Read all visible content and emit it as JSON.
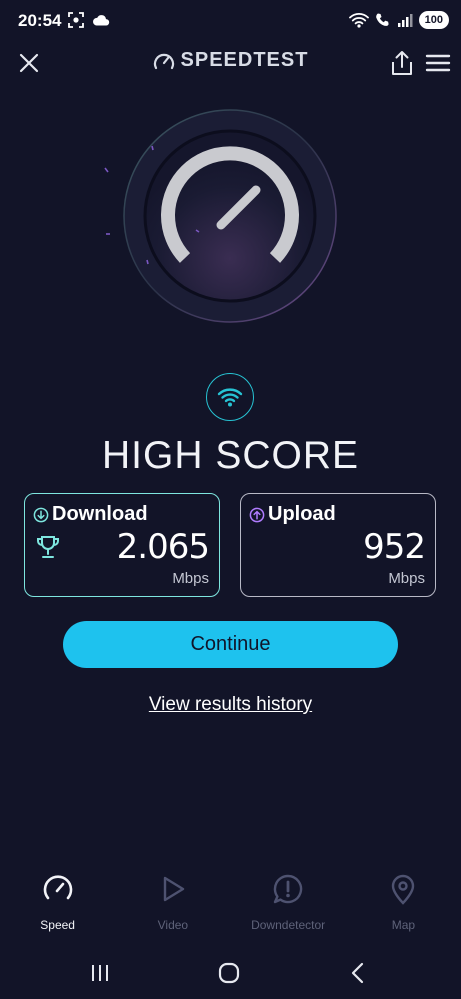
{
  "status_bar": {
    "time": "20:54",
    "battery": "100"
  },
  "app_bar": {
    "brand": "SPEEDTEST"
  },
  "result": {
    "headline": "HIGH SCORE",
    "download": {
      "label": "Download",
      "value": "2.065",
      "unit": "Mbps"
    },
    "upload": {
      "label": "Upload",
      "value": "952",
      "unit": "Mbps"
    }
  },
  "actions": {
    "continue_label": "Continue",
    "history_label": "View results history"
  },
  "bottom_nav": {
    "items": [
      {
        "label": "Speed",
        "icon": "gauge-icon",
        "active": true
      },
      {
        "label": "Video",
        "icon": "play-icon",
        "active": false
      },
      {
        "label": "Downdetector",
        "icon": "alert-icon",
        "active": false
      },
      {
        "label": "Map",
        "icon": "location-pin-icon",
        "active": false
      }
    ]
  },
  "colors": {
    "background": "#121428",
    "accent_cyan": "#1ec2ee",
    "download_border": "#7ee6df",
    "upload_icon": "#b07cff"
  }
}
